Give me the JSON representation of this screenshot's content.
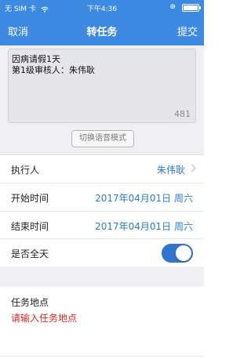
{
  "status_bar": {
    "carrier": "无 SIM 卡",
    "time": "下午4:36"
  },
  "nav": {
    "cancel": "取消",
    "title": "转任务",
    "submit": "提交"
  },
  "compose": {
    "text_line1": "因病请假1天",
    "text_line2": "第1级审核人：朱伟耿",
    "counter": "481",
    "voice_button": "切换语音模式"
  },
  "form": {
    "executor_label": "执行人",
    "executor_value": "朱伟耿",
    "start_label": "开始时间",
    "start_value": "2017年04月01日  周六",
    "end_label": "结束时间",
    "end_value": "2017年04月01日  周六",
    "all_day_label": "是否全天",
    "all_day_on": true,
    "location_label": "任务地点",
    "location_placeholder": "请输入任务地点"
  },
  "colors": {
    "header": "#3d8ae3",
    "accent": "#2a7ccf",
    "toggle": "#2f75cf",
    "placeholder": "#e02424",
    "section_bg": "#efeff4"
  }
}
